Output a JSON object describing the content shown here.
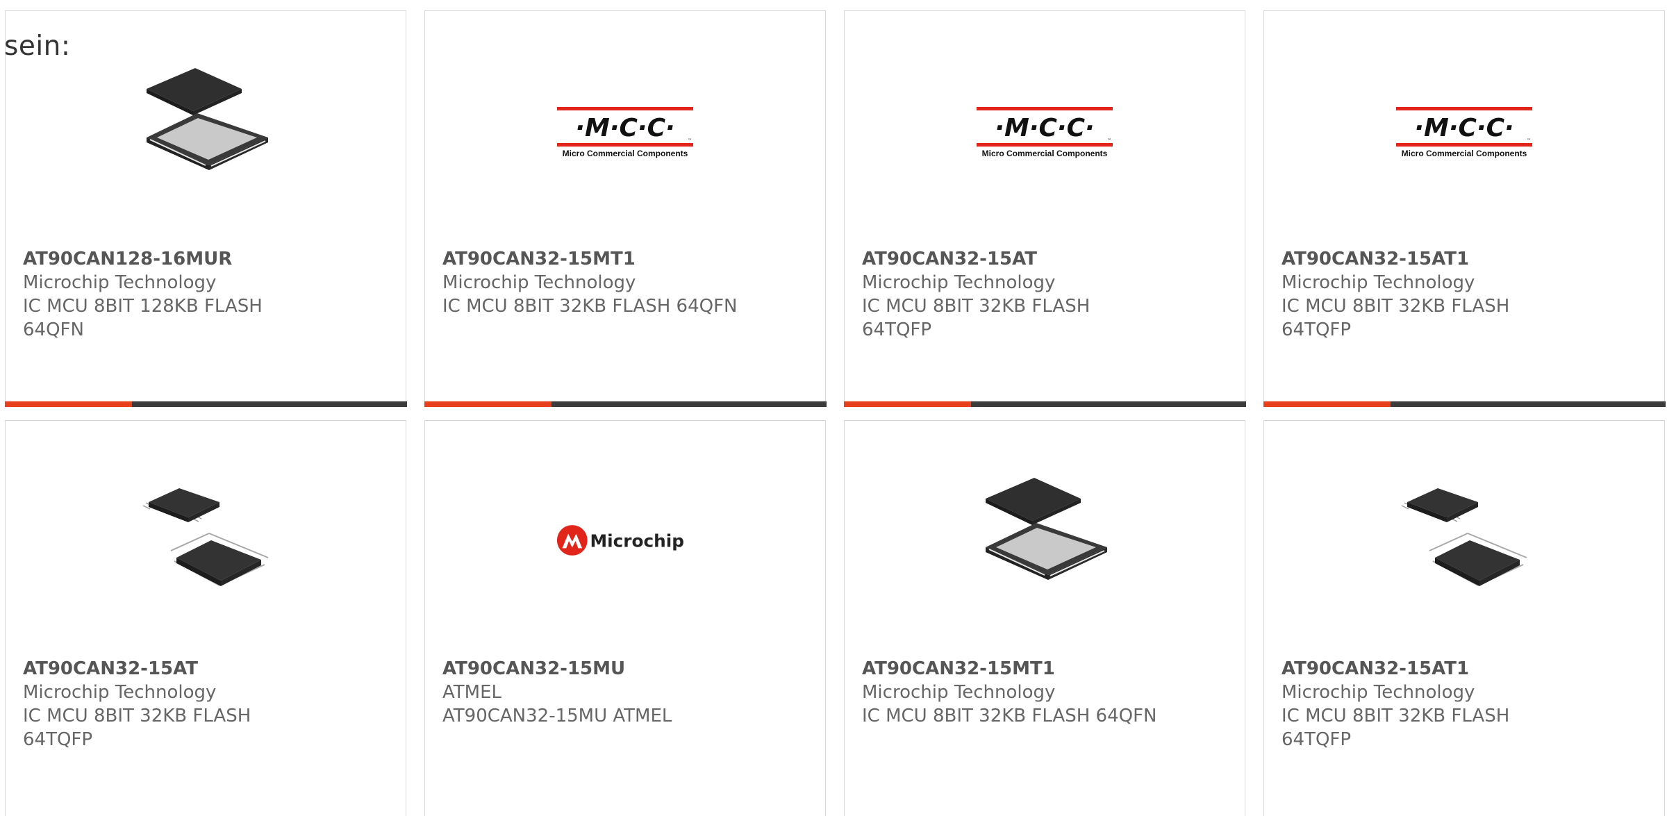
{
  "intro_text": "sein:",
  "colors": {
    "accent": "#e8401c",
    "bar_dark": "#3c3c3c",
    "mcc_red": "#e1251b",
    "microchip_red": "#e1251b"
  },
  "cards": [
    {
      "part_number": "AT90CAN128-16MUR",
      "manufacturer": "Microchip Technology",
      "description": "IC MCU 8BIT 128KB FLASH\n64QFN",
      "image": "qfn-chip-icon"
    },
    {
      "part_number": "AT90CAN32-15MT1",
      "manufacturer": "Microchip Technology",
      "description": "IC MCU 8BIT 32KB FLASH 64QFN",
      "image": "mcc-logo",
      "logo": {
        "text": "·M·C·C·",
        "subtitle": "Micro Commercial Components",
        "tm": "™"
      }
    },
    {
      "part_number": "AT90CAN32-15AT",
      "manufacturer": "Microchip Technology",
      "description": "IC MCU 8BIT 32KB FLASH\n64TQFP",
      "image": "mcc-logo",
      "logo": {
        "text": "·M·C·C·",
        "subtitle": "Micro Commercial Components",
        "tm": "™"
      }
    },
    {
      "part_number": "AT90CAN32-15AT1",
      "manufacturer": "Microchip Technology",
      "description": "IC MCU 8BIT 32KB FLASH\n64TQFP",
      "image": "mcc-logo",
      "logo": {
        "text": "·M·C·C·",
        "subtitle": "Micro Commercial Components",
        "tm": "™"
      }
    },
    {
      "part_number": "AT90CAN32-15AT",
      "manufacturer": "Microchip Technology",
      "description": "IC MCU 8BIT 32KB FLASH\n64TQFP",
      "image": "tqfp-chip-icon"
    },
    {
      "part_number": "AT90CAN32-15MU",
      "manufacturer": "ATMEL",
      "description": "AT90CAN32-15MU ATMEL",
      "image": "microchip-logo",
      "logo": {
        "text": "Microchip"
      }
    },
    {
      "part_number": "AT90CAN32-15MT1",
      "manufacturer": "Microchip Technology",
      "description": "IC MCU 8BIT 32KB FLASH 64QFN",
      "image": "qfn-chip-icon"
    },
    {
      "part_number": "AT90CAN32-15AT1",
      "manufacturer": "Microchip Technology",
      "description": "IC MCU 8BIT 32KB FLASH\n64TQFP",
      "image": "tqfp-chip-icon"
    }
  ]
}
